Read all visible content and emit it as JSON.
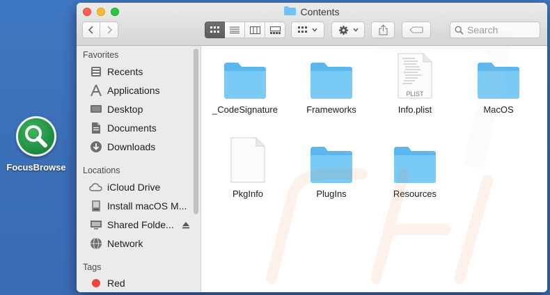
{
  "desktop": {
    "app_label": "FocusBrowse"
  },
  "window": {
    "title": "Contents",
    "search_placeholder": "Search"
  },
  "sidebar": {
    "favorites_heading": "Favorites",
    "favorites": [
      {
        "label": "Recents",
        "icon": "recents-icon"
      },
      {
        "label": "Applications",
        "icon": "applications-icon"
      },
      {
        "label": "Desktop",
        "icon": "desktop-icon"
      },
      {
        "label": "Documents",
        "icon": "documents-icon"
      },
      {
        "label": "Downloads",
        "icon": "downloads-icon"
      }
    ],
    "locations_heading": "Locations",
    "locations": [
      {
        "label": "iCloud Drive",
        "icon": "icloud-icon"
      },
      {
        "label": "Install macOS M...",
        "icon": "disk-icon"
      },
      {
        "label": "Shared Folde...",
        "icon": "display-icon"
      },
      {
        "label": "Network",
        "icon": "network-icon"
      }
    ],
    "tags_heading": "Tags",
    "tags": [
      {
        "label": "Red",
        "color": "#f0453c"
      }
    ]
  },
  "files": [
    {
      "name": "_CodeSignature",
      "kind": "folder"
    },
    {
      "name": "Frameworks",
      "kind": "folder"
    },
    {
      "name": "Info.plist",
      "kind": "plist",
      "badge": "PLIST"
    },
    {
      "name": "MacOS",
      "kind": "folder"
    },
    {
      "name": "PkgInfo",
      "kind": "document"
    },
    {
      "name": "PlugIns",
      "kind": "folder"
    },
    {
      "name": "Resources",
      "kind": "folder"
    }
  ],
  "colors": {
    "folder": "#6ec4f4",
    "desktop_bg": "#3d73bd",
    "app_green": "#229044"
  }
}
